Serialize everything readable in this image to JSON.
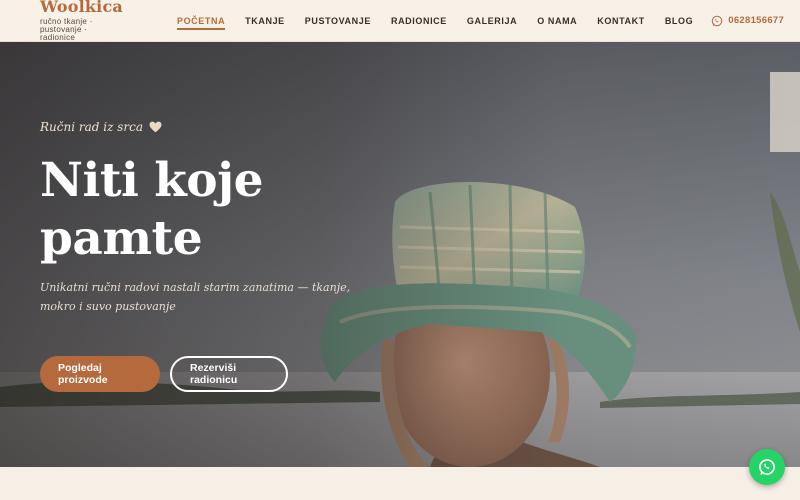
{
  "brand": {
    "name": "Woolkica",
    "tagline": "ručno tkanje · pustovanje · radionice"
  },
  "nav": {
    "items": [
      {
        "label": "POČETNA",
        "active": true
      },
      {
        "label": "TKANJE"
      },
      {
        "label": "PUSTOVANJE"
      },
      {
        "label": "RADIONICE"
      },
      {
        "label": "GALERIJA"
      },
      {
        "label": "O NAMA"
      },
      {
        "label": "KONTAKT"
      },
      {
        "label": "BLOG"
      }
    ],
    "phone": "0628156677",
    "phone_icon": "whatsapp-icon"
  },
  "hero": {
    "kicker": "Ručni rad iz srca",
    "kicker_icon": "heart-icon",
    "title": "Niti koje pamte",
    "subtitle": "Unikatni ručni radovi nastali starim zanatima — tkanje, mokro i suvo pustovanje",
    "primary_button": "Pogledaj proizvode",
    "secondary_button": "Rezerviši radionicu"
  },
  "fab": {
    "icon": "whatsapp-icon"
  },
  "colors": {
    "accent": "#b56a3e",
    "header_bg": "#f7f1e8",
    "whatsapp": "#25d366"
  }
}
